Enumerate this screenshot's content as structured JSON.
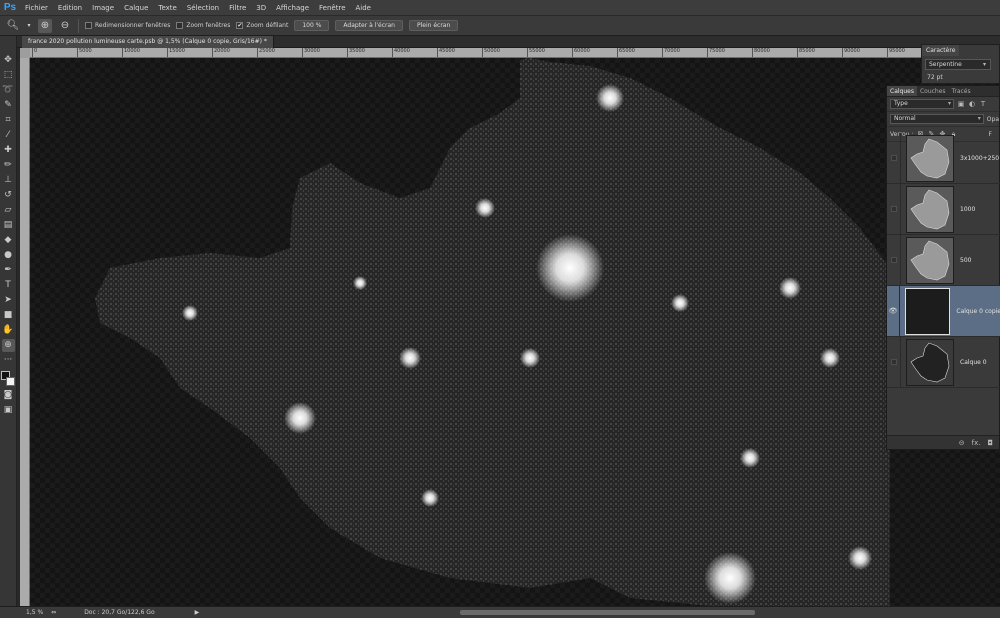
{
  "app": {
    "logo": "Ps"
  },
  "menu": [
    "Fichier",
    "Edition",
    "Image",
    "Calque",
    "Texte",
    "Sélection",
    "Filtre",
    "3D",
    "Affichage",
    "Fenêtre",
    "Aide"
  ],
  "options": {
    "resize_windows": "Redimensionner fenêtres",
    "zoom_windows": "Zoom fenêtres",
    "scrubby_zoom": "Zoom défilant",
    "scrubby_checked": "✔",
    "zoom_100": "100 %",
    "fit_screen": "Adapter à l'écran",
    "full_screen": "Plein écran"
  },
  "document": {
    "tab_title": "france 2020 pollution lumineuse carte.psb @ 1,5% (Calque 0 copie, Gris/16#) *"
  },
  "ruler": {
    "h_labels": [
      "0",
      "5000",
      "10000",
      "15000",
      "20000",
      "25000",
      "30000",
      "35000",
      "40000",
      "45000",
      "50000",
      "55000",
      "60000",
      "65000",
      "70000",
      "75000",
      "80000",
      "85000",
      "90000",
      "95000"
    ]
  },
  "character_panel": {
    "tab": "Caractère",
    "font": "Serpentine",
    "size": "72 pt"
  },
  "layers_panel": {
    "tabs": [
      "Calques",
      "Couches",
      "Tracés"
    ],
    "filter": "Type",
    "blend_mode": "Normal",
    "opacity_label": "Opa",
    "lock_label": "Verrou :",
    "fill_label": "F",
    "layers": [
      {
        "name": "3x1000+250",
        "visible": false,
        "selected": false
      },
      {
        "name": "1000",
        "visible": false,
        "selected": false
      },
      {
        "name": "500",
        "visible": false,
        "selected": false
      },
      {
        "name": "Calque 0 copie",
        "visible": true,
        "selected": true
      },
      {
        "name": "Calque 0",
        "visible": false,
        "selected": false
      }
    ],
    "footer_link": "⊝",
    "footer_fx": "fx."
  },
  "status": {
    "zoom": "1,5 %",
    "doc": "Doc : 20,7 Go/122,6 Go",
    "play": "▶"
  },
  "colors": {
    "accent_selected_layer": "#5c6e85",
    "ps_blue": "#31a8ff"
  }
}
